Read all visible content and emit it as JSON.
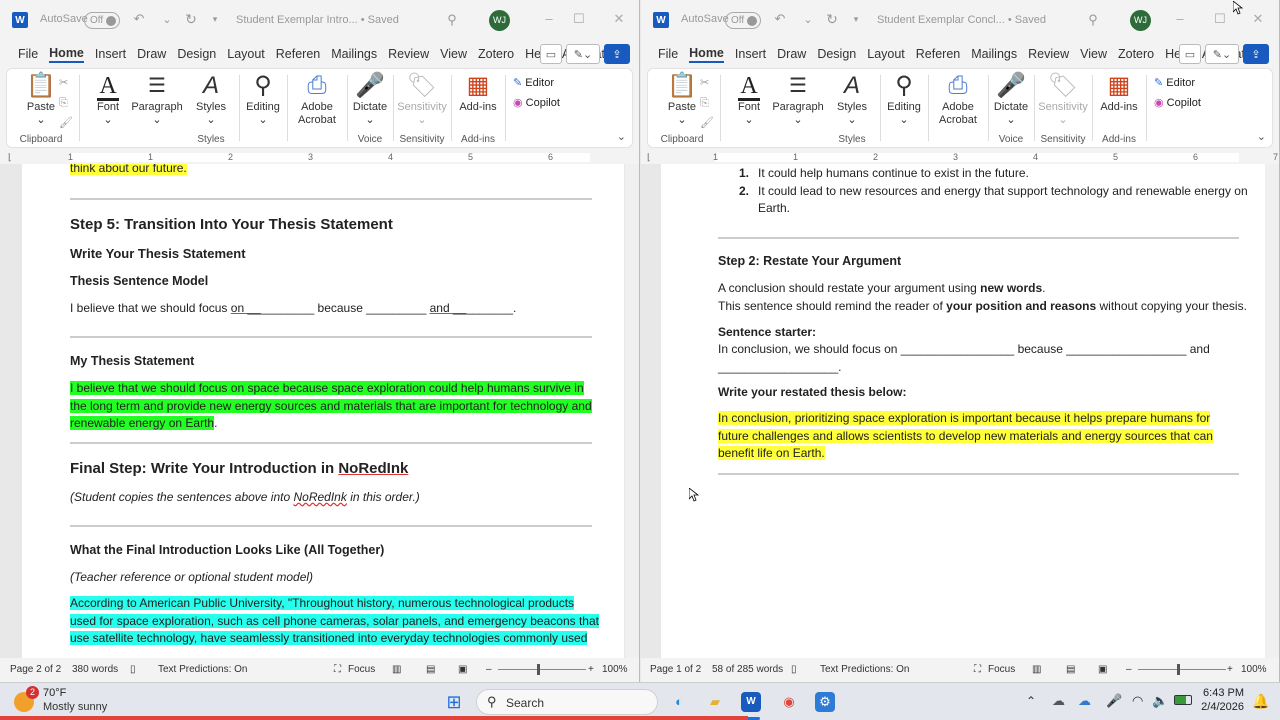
{
  "left_window": {
    "autosave_label": "AutoSave",
    "autosave_state": "Off",
    "title": "Student Exemplar Intro... • Saved",
    "avatar": "WJ",
    "menu": [
      "File",
      "Home",
      "Insert",
      "Draw",
      "Design",
      "Layout",
      "Referen",
      "Mailings",
      "Review",
      "View",
      "Zotero",
      "Help",
      "Acrobat"
    ],
    "ribbon": {
      "paste": "Paste",
      "font": "Font",
      "paragraph": "Paragraph",
      "styles": "Styles",
      "editing": "Editing",
      "adobe": "Adobe",
      "acrobat": "Acrobat",
      "dictate": "Dictate",
      "sensitivity": "Sensitivity",
      "addins": "Add-ins",
      "editor": "Editor",
      "copilot": "Copilot",
      "g_clipboard": "Clipboard",
      "g_styles": "Styles",
      "g_voice": "Voice",
      "g_sensitivity": "Sensitivity",
      "g_addins": "Add-ins"
    },
    "ruler_nums": [
      "1",
      "1",
      "2",
      "3",
      "4",
      "5",
      "6"
    ],
    "doc": {
      "top_fragment": "think about our future.",
      "step5_heading": "Step 5: Transition Into Your Thesis Statement",
      "write_thesis": "Write Your Thesis Statement",
      "thesis_model": "Thesis Sentence Model",
      "model_a": "I believe that we should focus ",
      "model_on": "on __",
      "model_b": "________ because _________ ",
      "model_and": "and __",
      "model_c": "_______.",
      "my_thesis": "My Thesis Statement",
      "thesis_l1": "I believe that we should focus on space because space exploration could help humans survive in",
      "thesis_l2": "the long term and provide new energy sources and materials that are important for technology and",
      "thesis_l3": "renewable energy on Earth",
      "thesis_end": ".",
      "final_a": "Final Step: Write Your Introduction in ",
      "final_b": "NoRedInk",
      "copies_a": "(Student copies the sentences above into ",
      "copies_b": "NoRedInk",
      "copies_c": " in this order.)",
      "final_intro": "What the Final Introduction Looks Like (All Together)",
      "teacher_ref": "(Teacher reference or optional student model)",
      "intro_l1": "According to American Public University, \"Throughout history, numerous technological products",
      "intro_l2": "used for space exploration, such as cell phone cameras, solar panels, and emergency beacons that",
      "intro_l3": "use satellite technology, have seamlessly transitioned into everyday technologies commonly used"
    },
    "status": {
      "page": "Page 2 of 2",
      "words": "380 words",
      "predictions": "Text Predictions: On",
      "focus": "Focus",
      "zoom": "100%"
    }
  },
  "right_window": {
    "autosave_label": "AutoSave",
    "autosave_state": "Off",
    "title": "Student Exemplar Concl... • Saved",
    "avatar": "WJ",
    "menu": [
      "File",
      "Home",
      "Insert",
      "Draw",
      "Design",
      "Layout",
      "Referen",
      "Mailings",
      "Review",
      "View",
      "Zotero",
      "Help",
      "Acrobat"
    ],
    "ribbon": {
      "paste": "Paste",
      "font": "Font",
      "paragraph": "Paragraph",
      "styles": "Styles",
      "editing": "Editing",
      "adobe": "Adobe",
      "acrobat": "Acrobat",
      "dictate": "Dictate",
      "sensitivity": "Sensitivity",
      "addins": "Add-ins",
      "editor": "Editor",
      "copilot": "Copilot",
      "g_clipboard": "Clipboard",
      "g_styles": "Styles",
      "g_voice": "Voice",
      "g_sensitivity": "Sensitivity",
      "g_addins": "Add-ins"
    },
    "ruler_nums": [
      "1",
      "1",
      "2",
      "3",
      "4",
      "5",
      "6",
      "7"
    ],
    "doc": {
      "li1_num": "1.",
      "li1": "It could help humans continue to exist in the future.",
      "li2_num": "2.",
      "li2a": "It could lead to new resources and energy that support technology and renewable energy on",
      "li2b": "Earth.",
      "step2": "Step 2: Restate Your Argument",
      "conc_a": "A conclusion should restate your argument using ",
      "conc_b": "new words",
      "conc_c": ".",
      "remind_a": "This sentence should remind the reader of ",
      "remind_b": "your position and reasons",
      "remind_c": " without copying your thesis.",
      "starter": "Sentence starter:",
      "starter_l1": "In conclusion, we should focus on _________________ because __________________ and",
      "starter_l2": "__________________.",
      "write_restated": "Write your restated thesis below:",
      "rest_l1": "In conclusion, prioritizing space exploration is important because it helps prepare humans for",
      "rest_l2": "future challenges and allows scientists to develop new materials and energy sources that can",
      "rest_l3": "benefit life on Earth."
    },
    "status": {
      "page": "Page 1 of 2",
      "words": "58 of 285 words",
      "predictions": "Text Predictions: On",
      "focus": "Focus",
      "zoom": "100%"
    }
  },
  "taskbar": {
    "weather_badge": "2",
    "temp": "70°F",
    "condition": "Mostly sunny",
    "search": "Search",
    "time": "6:43 PM",
    "date": "2/4/2026"
  }
}
